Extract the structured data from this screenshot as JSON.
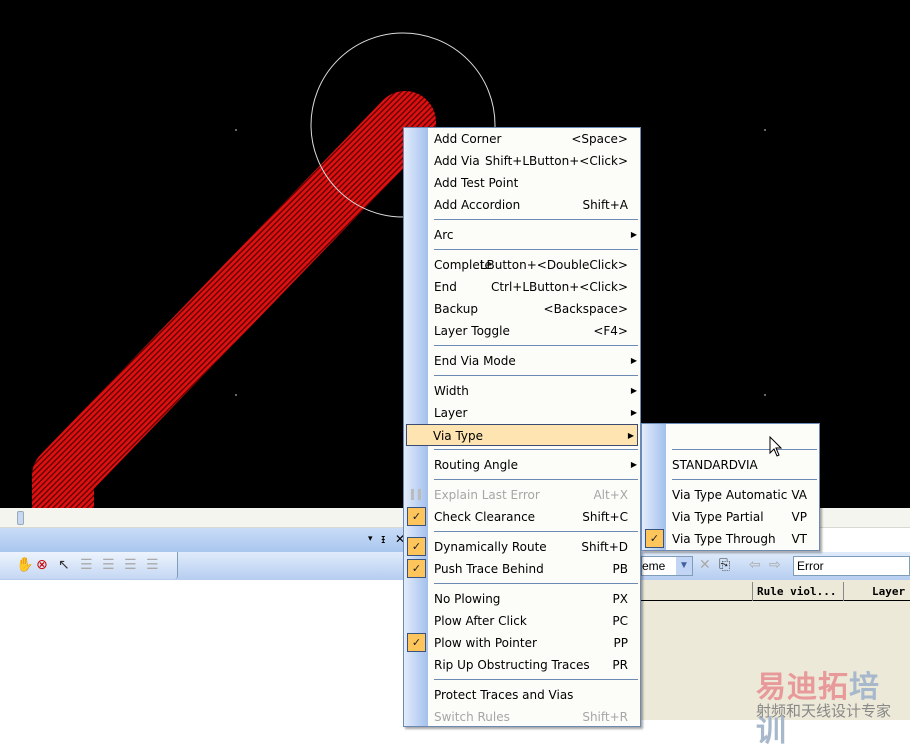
{
  "menu": {
    "items": [
      {
        "label": "Add Corner",
        "shortcut": "<Space>"
      },
      {
        "label": "Add Via",
        "shortcut": "Shift+LButton+<Click>"
      },
      {
        "label": "Add Test Point",
        "shortcut": ""
      },
      {
        "label": "Add Accordion",
        "shortcut": "Shift+A"
      },
      {
        "label": "Arc",
        "shortcut": ""
      },
      {
        "label": "Complete",
        "shortcut": "LButton+<DoubleClick>"
      },
      {
        "label": "End",
        "shortcut": "Ctrl+LButton+<Click>"
      },
      {
        "label": "Backup",
        "shortcut": "<Backspace>"
      },
      {
        "label": "Layer Toggle",
        "shortcut": "<F4>"
      },
      {
        "label": "End Via Mode",
        "shortcut": ""
      },
      {
        "label": "Width",
        "shortcut": ""
      },
      {
        "label": "Layer",
        "shortcut": ""
      },
      {
        "label": "Via Type",
        "shortcut": ""
      },
      {
        "label": "Routing Angle",
        "shortcut": ""
      },
      {
        "label": "Explain Last Error",
        "shortcut": "Alt+X"
      },
      {
        "label": "Check Clearance",
        "shortcut": "Shift+C"
      },
      {
        "label": "Dynamically Route",
        "shortcut": "Shift+D"
      },
      {
        "label": "Push Trace Behind",
        "shortcut": "PB"
      },
      {
        "label": "No Plowing",
        "shortcut": "PX"
      },
      {
        "label": "Plow After Click",
        "shortcut": "PC"
      },
      {
        "label": "Plow with Pointer",
        "shortcut": "PP"
      },
      {
        "label": "Rip Up Obstructing Traces",
        "shortcut": "PR"
      },
      {
        "label": "Protect Traces and Vias",
        "shortcut": ""
      },
      {
        "label": "Switch Rules",
        "shortcut": "Shift+R"
      }
    ]
  },
  "submenu": {
    "items": [
      {
        "label": "",
        "shortcut": ""
      },
      {
        "label": "STANDARDVIA",
        "shortcut": ""
      },
      {
        "label": "Via Type Automatic",
        "shortcut": "VA"
      },
      {
        "label": "Via Type Partial",
        "shortcut": "VP"
      },
      {
        "label": "Via Type Through",
        "shortcut": "VT"
      }
    ]
  },
  "panel": {
    "controls": {
      "dropdown": "▾",
      "pin": "ᵻ",
      "close": "✕"
    }
  },
  "right": {
    "scheme_combo": "eme",
    "filter_value": "Error",
    "columns": [
      "Rule viol...",
      "Layer"
    ]
  },
  "watermark": {
    "line1a": "易迪拓",
    "line1b": "培训",
    "line2": "射频和天线设计专家"
  },
  "colors": {
    "trace": "#e01010",
    "canvas": "#000000",
    "highlight": "#fde4b0",
    "check": "#fdc55c"
  }
}
